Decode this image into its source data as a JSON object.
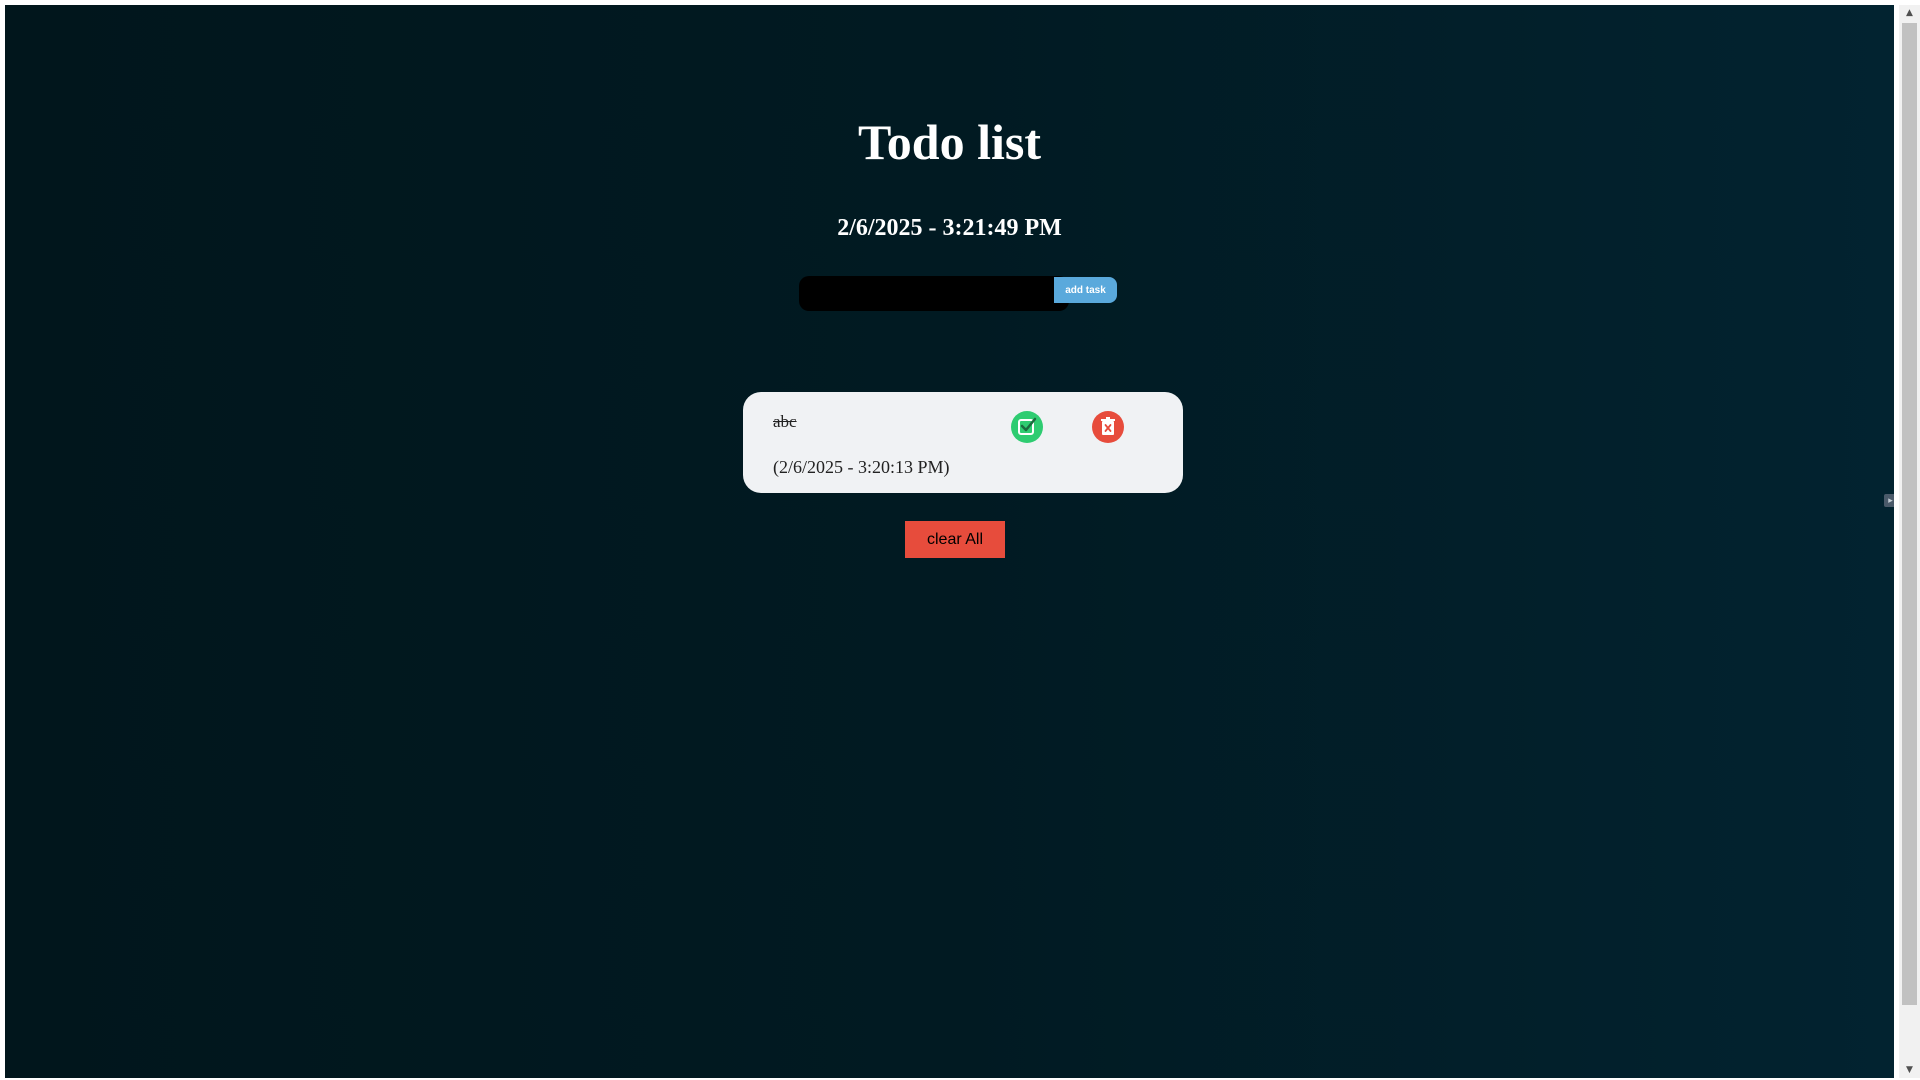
{
  "app": {
    "title": "Todo list",
    "clock": "2/6/2025 - 3:21:49 PM"
  },
  "form": {
    "input_value": "",
    "add_label": "add task"
  },
  "tasks": [
    {
      "text": "abc",
      "timestamp": "(2/6/2025 - 3:20:13 PM)",
      "completed": true,
      "complete_icon": "check-square-icon",
      "delete_icon": "trash-x-icon"
    }
  ],
  "actions": {
    "clear_label": "clear All"
  },
  "colors": {
    "background_dark": "#01161c",
    "add_button": "#5aa9dc",
    "complete_button": "#2ecc71",
    "delete_button": "#e74c3c",
    "card_background": "#f0f2f4"
  }
}
